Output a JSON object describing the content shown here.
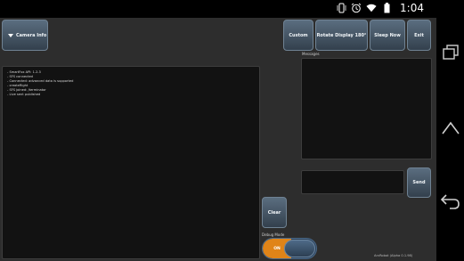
{
  "status_bar": {
    "time": "1:04",
    "icons": [
      "vibrate-icon",
      "alarm-icon",
      "wifi-icon",
      "battery-icon"
    ]
  },
  "toolbar": {
    "camera_info_label": "Camera Info",
    "custom_label": "Custom",
    "rotate_label": "Rotate Display 180°",
    "sleep_label": "Sleep Now",
    "exit_label": "Exit"
  },
  "log": {
    "lines": [
      "- SmartFox API: 1.2.3",
      "- SFS connected",
      "- Connected: advanced data is supported",
      "- createRight",
      "- SFS joined: /terminator",
      "- Live sent published"
    ]
  },
  "messages": {
    "label": "Messages"
  },
  "send": {
    "input_value": "",
    "button_label": "Send"
  },
  "clear_label": "Clear",
  "debug": {
    "label": "Debug Mode",
    "toggle_state": "ON"
  },
  "version_text": "ArvRobot (Alpha 0.1.98)",
  "colors": {
    "background": "#2d2d2d",
    "panel": "#121212",
    "button": "#4a5c6e",
    "toggle_on": "#e08418",
    "toggle_off": "#2a3f57"
  },
  "nav_bar": {
    "icons": [
      "recents-icon",
      "home-icon",
      "back-icon"
    ]
  }
}
